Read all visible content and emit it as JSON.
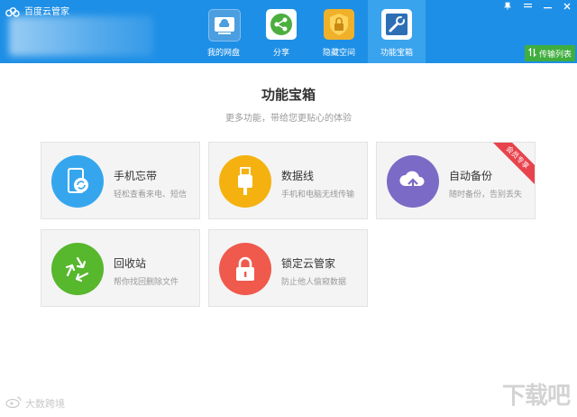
{
  "window": {
    "app_title": "百度云管家",
    "controls": {
      "pin": "pin-icon",
      "menu": "menu-icon",
      "minimize": "minimize-icon",
      "close": "close-icon"
    },
    "transfer_list_label": "传输列表"
  },
  "nav": {
    "tabs": [
      {
        "label": "我的网盘",
        "icon": "cloud-drive-icon",
        "active": false
      },
      {
        "label": "分享",
        "icon": "share-icon",
        "active": false
      },
      {
        "label": "隐藏空间",
        "icon": "lock-safe-icon",
        "active": false
      },
      {
        "label": "功能宝箱",
        "icon": "toolbox-icon",
        "active": true
      }
    ]
  },
  "main": {
    "title": "功能宝箱",
    "subtitle": "更多功能，带给您更贴心的体验",
    "cards": [
      {
        "title": "手机忘带",
        "desc": "轻松查看来电、短信",
        "icon": "phone-sync-icon",
        "color": "#35a6ee"
      },
      {
        "title": "数据线",
        "desc": "手机和电脑无线传输",
        "icon": "usb-cable-icon",
        "color": "#f5b10f"
      },
      {
        "title": "自动备份",
        "desc": "随时备份，告别丢失",
        "icon": "cloud-upload-icon",
        "color": "#7b6bc6",
        "badge": "会员专享"
      },
      {
        "title": "回收站",
        "desc": "帮你找回删除文件",
        "icon": "recycle-icon",
        "color": "#57b72d"
      },
      {
        "title": "锁定云管家",
        "desc": "防止他人偷窥数据",
        "icon": "lock-icon",
        "color": "#ef5a4d"
      }
    ]
  },
  "watermarks": {
    "left": "大数跨境",
    "right": "下载吧"
  }
}
